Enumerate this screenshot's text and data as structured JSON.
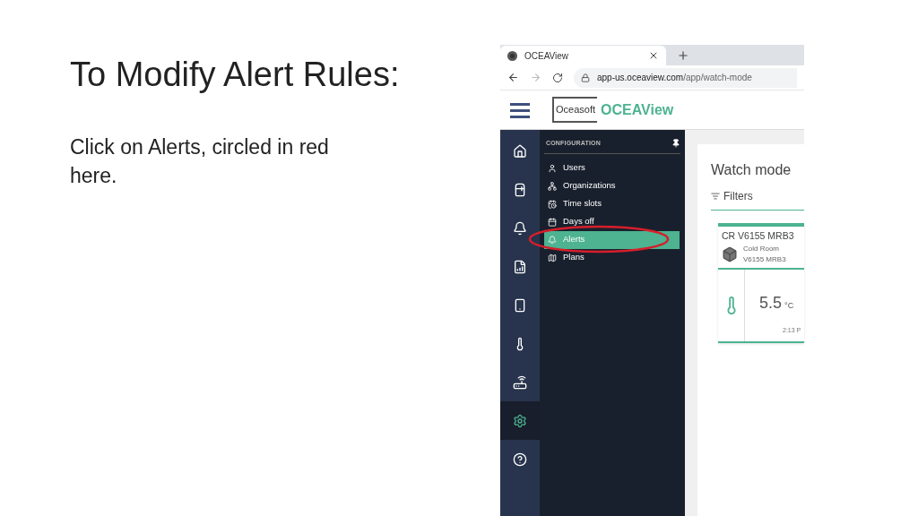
{
  "slide": {
    "title": "To Modify Alert Rules:",
    "body": "Click on Alerts, circled in red here."
  },
  "browser": {
    "tab_title": "OCEAView",
    "url_host": "app-us.oceaview.com",
    "url_path": "/app/watch-mode"
  },
  "app": {
    "logo_text": "Oceasoft",
    "app_name": "OCEAView"
  },
  "rail": [
    {
      "kind": "home",
      "selected": false
    },
    {
      "kind": "fridge",
      "selected": false
    },
    {
      "kind": "bell",
      "selected": false
    },
    {
      "kind": "report",
      "selected": false
    },
    {
      "kind": "sensor",
      "selected": false
    },
    {
      "kind": "thermometer",
      "selected": false
    },
    {
      "kind": "router",
      "selected": false
    },
    {
      "kind": "settings",
      "selected": true
    },
    {
      "kind": "help",
      "selected": false
    }
  ],
  "menu": {
    "heading": "CONFIGURATION",
    "items": [
      {
        "label": "Users",
        "kind": "user",
        "selected": false,
        "circled": false
      },
      {
        "label": "Organizations",
        "kind": "org",
        "selected": false,
        "circled": false
      },
      {
        "label": "Time slots",
        "kind": "timeslot",
        "selected": false,
        "circled": false
      },
      {
        "label": "Days off",
        "kind": "calendar",
        "selected": false,
        "circled": false
      },
      {
        "label": "Alerts",
        "kind": "bell",
        "selected": true,
        "circled": true
      },
      {
        "label": "Plans",
        "kind": "map",
        "selected": false,
        "circled": false
      }
    ]
  },
  "content": {
    "title": "Watch mode",
    "filters": "Filters",
    "card": {
      "name": "CR V6155 MRB3",
      "type": "Cold Room",
      "serial": "V6155 MRB3",
      "value": "5.5",
      "unit": "°C",
      "time": "2:13 P"
    }
  }
}
